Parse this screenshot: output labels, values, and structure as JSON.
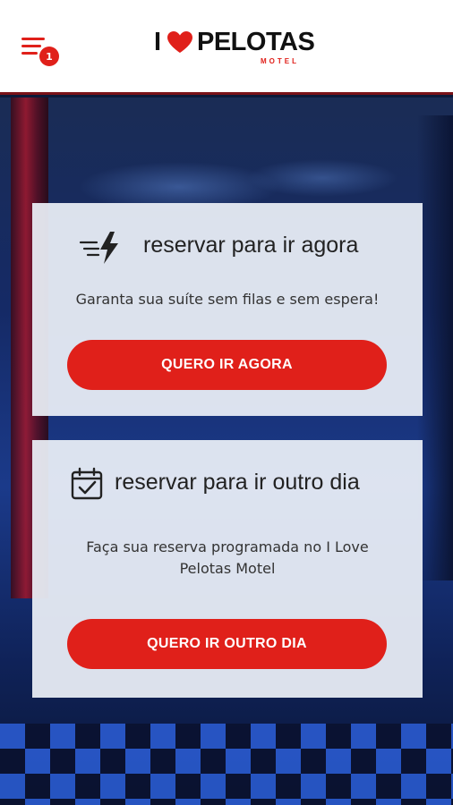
{
  "header": {
    "menu_badge": "1",
    "logo": {
      "letter": "I",
      "name": "PELOTAS",
      "sub": "MOTEL"
    }
  },
  "cards": {
    "now": {
      "title": "reservar para ir agora",
      "description": "Garanta sua suíte sem filas e sem espera!",
      "button": "QUERO IR AGORA"
    },
    "later": {
      "title": "reservar para ir outro dia",
      "description": "Faça sua reserva programada no I Love Pelotas Motel",
      "button": "QUERO IR OUTRO DIA"
    }
  },
  "colors": {
    "accent": "#e0201a",
    "card_bg": "#eceff8",
    "text": "#222222"
  },
  "icons": {
    "menu": "menu-icon",
    "heart": "heart-icon",
    "bolt": "lightning-bolt-icon",
    "calendar": "calendar-check-icon"
  }
}
